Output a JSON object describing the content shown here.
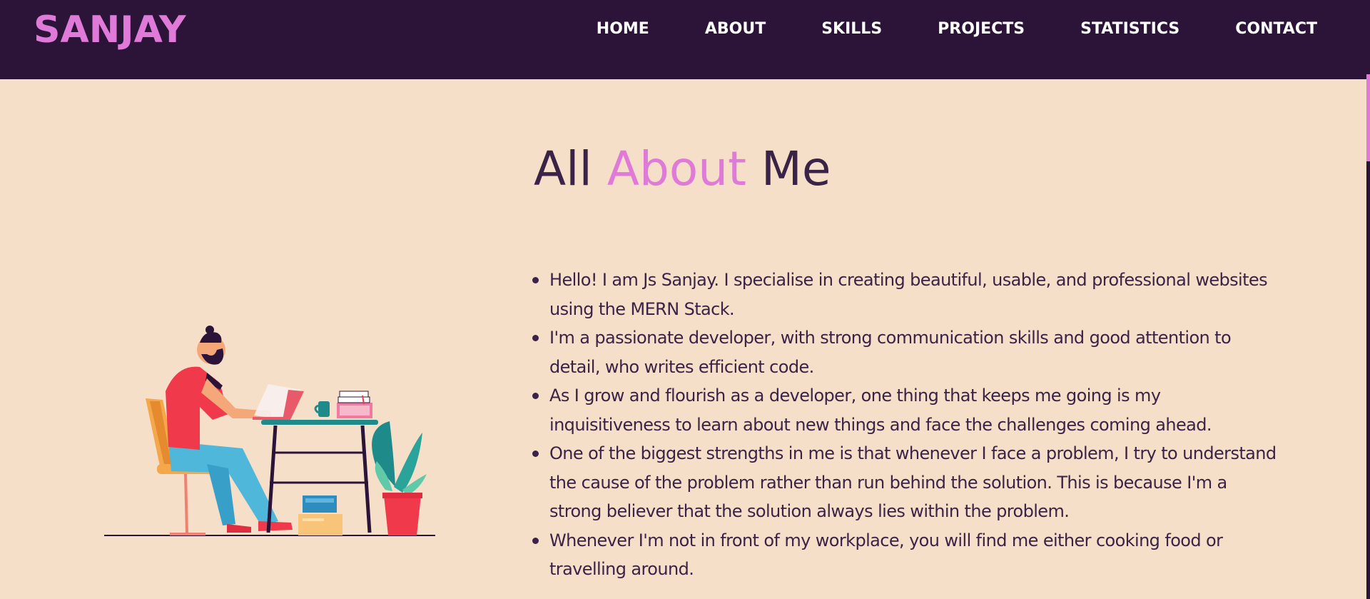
{
  "header": {
    "logo": "SANJAY",
    "nav": [
      "HOME",
      "ABOUT",
      "SKILLS",
      "PROJECTS",
      "STATISTICS",
      "CONTACT"
    ]
  },
  "about": {
    "title_part1": "All ",
    "title_accent": "About",
    "title_part2": " Me",
    "bullets": [
      "Hello! I am Js Sanjay. I specialise in creating beautiful, usable, and professional websites using the MERN Stack.",
      "I'm a passionate developer, with strong communication skills and good attention to detail, who writes efficient code.",
      "As I grow and flourish as a developer, one thing that keeps me going is my inquisitiveness to learn about new things and face the challenges coming ahead.",
      "One of the biggest strengths in me is that whenever I face a problem, I try to understand the cause of the problem rather than run behind the solution. This is because I'm a strong believer that the solution always lies within the problem.",
      "Whenever I'm not in front of my workplace, you will find me either cooking food or travelling around."
    ]
  },
  "colors": {
    "navbar_bg": "#2c1439",
    "page_bg": "#f6dfc8",
    "accent": "#e07ad8",
    "text": "#3a2346"
  }
}
